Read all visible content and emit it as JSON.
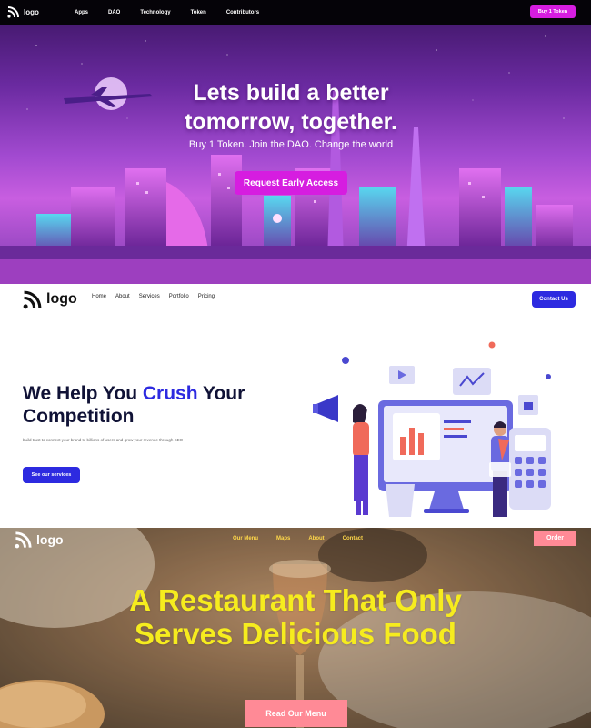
{
  "dao": {
    "logo_label": "logo",
    "nav": [
      "Apps",
      "DAO",
      "Technology",
      "Token",
      "Contributors"
    ],
    "cta": "Buy 1 Token",
    "title_line1": "Lets build a better",
    "title_line2": "tomorrow, together.",
    "subtitle": "Buy 1 Token. Join the DAO. Change the world",
    "button": "Request Early Access",
    "colors": {
      "accent": "#d61de0",
      "nav_bg": "#050308"
    }
  },
  "seo": {
    "logo_label": "logo",
    "nav": [
      "Home",
      "About",
      "Services",
      "Portfolio",
      "Pricing"
    ],
    "cta": "Contact Us",
    "title_part1": "We Help You ",
    "title_accent": "Crush",
    "title_part2": " Your Competition",
    "subtitle": "build trust to connect your brand to billions of users and grow your revenue through SEO",
    "button": "See our services",
    "colors": {
      "accent": "#2d2ae0",
      "heading": "#101236"
    }
  },
  "restaurant": {
    "logo_label": "logo",
    "nav": [
      "Our Menu",
      "Maps",
      "About",
      "Contact"
    ],
    "cta": "Order",
    "title": "A Restaurant That Only Serves Delicious Food",
    "button": "Read Our Menu",
    "colors": {
      "title": "#f6ec1e",
      "accent": "#ff8a96",
      "nav_link": "#ffd84a"
    }
  }
}
